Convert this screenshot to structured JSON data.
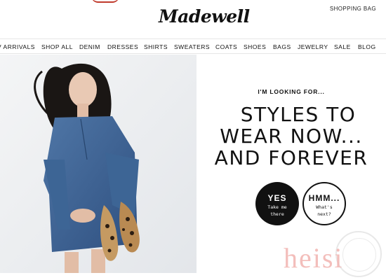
{
  "header": {
    "logo": "Madewell",
    "shopping_bag": "SHOPPING BAG"
  },
  "nav": {
    "items": [
      "V ARRIVALS",
      "SHOP ALL",
      "DENIM",
      "DRESSES",
      "SHIRTS",
      "SWEATERS",
      "COATS",
      "SHOES",
      "BAGS",
      "JEWELRY",
      "SALE",
      "BLOG"
    ]
  },
  "hero": {
    "looking_for": "I'M LOOKING FOR...",
    "tagline": [
      "STYLES TO",
      "WEAR NOW...",
      "AND FOREVER"
    ],
    "yes_button": {
      "title": "YES",
      "sub_1": "Take me",
      "sub_2": "there"
    },
    "hmm_button": {
      "title": "HMM...",
      "sub_1": "What's",
      "sub_2": "next?"
    }
  },
  "watermark": "heisi",
  "colors": {
    "brand_text": "#111111",
    "watermark": "#f2b3b0",
    "denim": "#3a5f8f"
  }
}
